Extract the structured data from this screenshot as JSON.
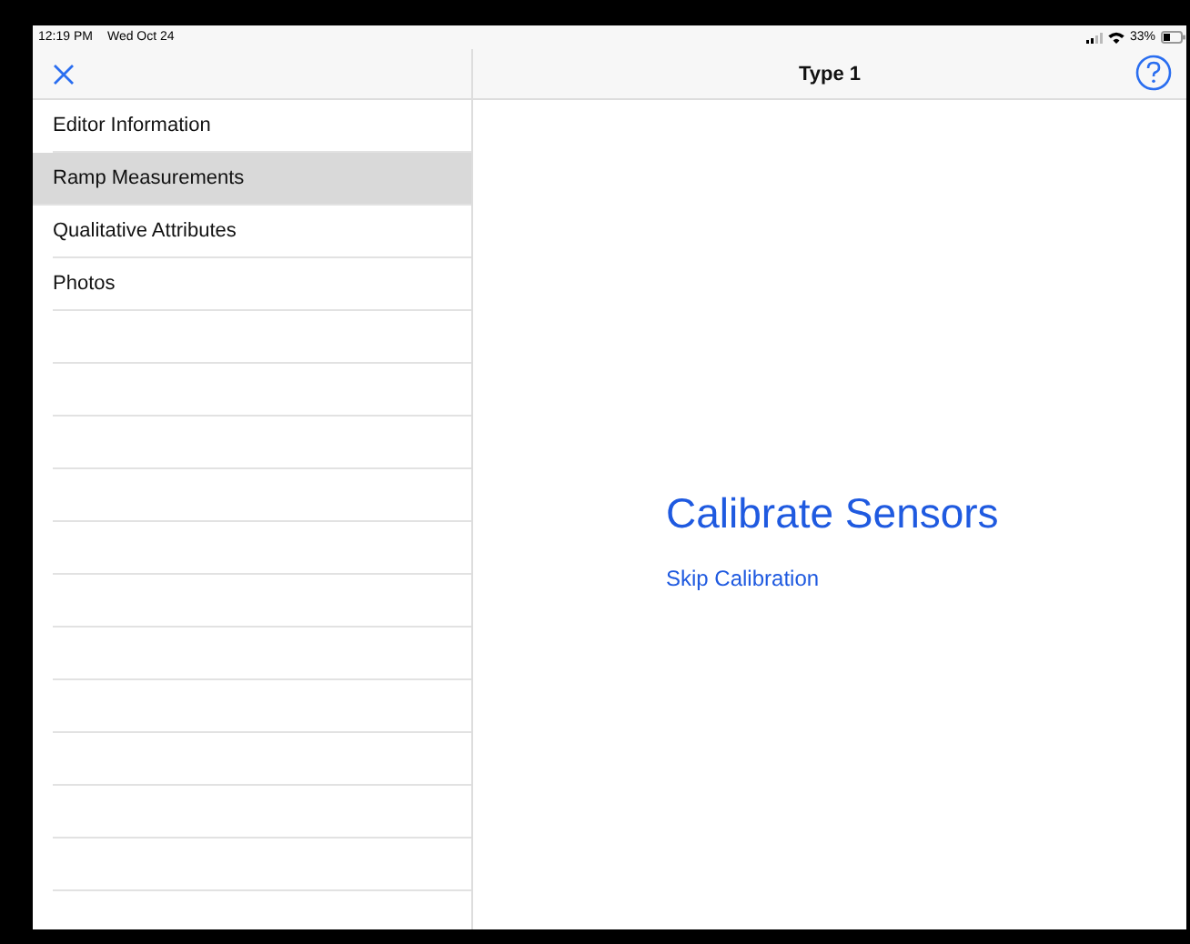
{
  "status_bar": {
    "time": "12:19 PM",
    "date": "Wed Oct 24",
    "battery": "33%"
  },
  "nav": {
    "title": "Type 1"
  },
  "sidebar": {
    "items": [
      {
        "label": "Editor Information",
        "selected": false
      },
      {
        "label": "Ramp Measurements",
        "selected": true
      },
      {
        "label": "Qualitative Attributes",
        "selected": false
      },
      {
        "label": "Photos",
        "selected": false
      }
    ]
  },
  "main": {
    "heading": "Calibrate Sensors",
    "link": "Skip Calibration"
  }
}
